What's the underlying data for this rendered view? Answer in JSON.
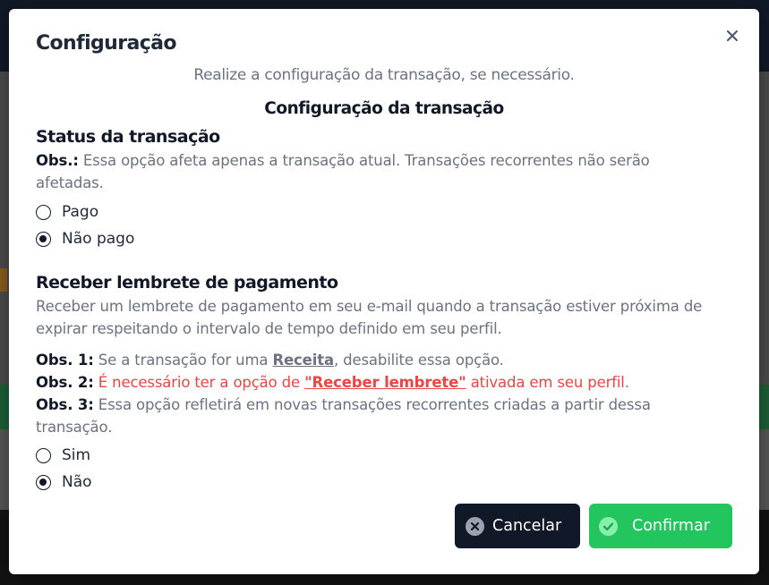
{
  "modal": {
    "title": "Configuração",
    "subtitle": "Realize a configuração da transação, se necessário.",
    "section_heading": "Configuração da transação"
  },
  "status": {
    "heading": "Status da transação",
    "obs_label": "Obs.:",
    "obs_text": " Essa opção afeta apenas a transação atual. Transações recorrentes não serão afetadas.",
    "options": [
      "Pago",
      "Não pago"
    ],
    "selected": "Não pago"
  },
  "reminder": {
    "heading": "Receber lembrete de pagamento",
    "description": "Receber um lembrete de pagamento em seu e-mail quando a transação estiver próxima de expirar respeitando o intervalo de tempo definido em seu perfil.",
    "obs1_label": "Obs. 1:",
    "obs1_pre": " Se a transação for uma ",
    "obs1_link": "Receita",
    "obs1_post": ", desabilite essa opção.",
    "obs2_label": "Obs. 2:",
    "obs2_pre": " É necessário ter a opção de ",
    "obs2_link": "\"Receber lembrete\"",
    "obs2_post": " ativada em seu perfil.",
    "obs3_label": "Obs. 3:",
    "obs3_text": " Essa opção refletirá em novas transações recorrentes criadas a partir dessa transação.",
    "options": [
      "Sim",
      "Não"
    ],
    "selected": "Não"
  },
  "footer": {
    "cancel_label": "Cancelar",
    "confirm_label": "Confirmar"
  },
  "icons": {
    "close": "close-icon",
    "cancel": "x-circle-icon",
    "confirm": "check-circle-icon"
  },
  "colors": {
    "primary_dark": "#111827",
    "success": "#22c55e",
    "danger": "#ef4444",
    "muted_text": "#6b7280"
  }
}
